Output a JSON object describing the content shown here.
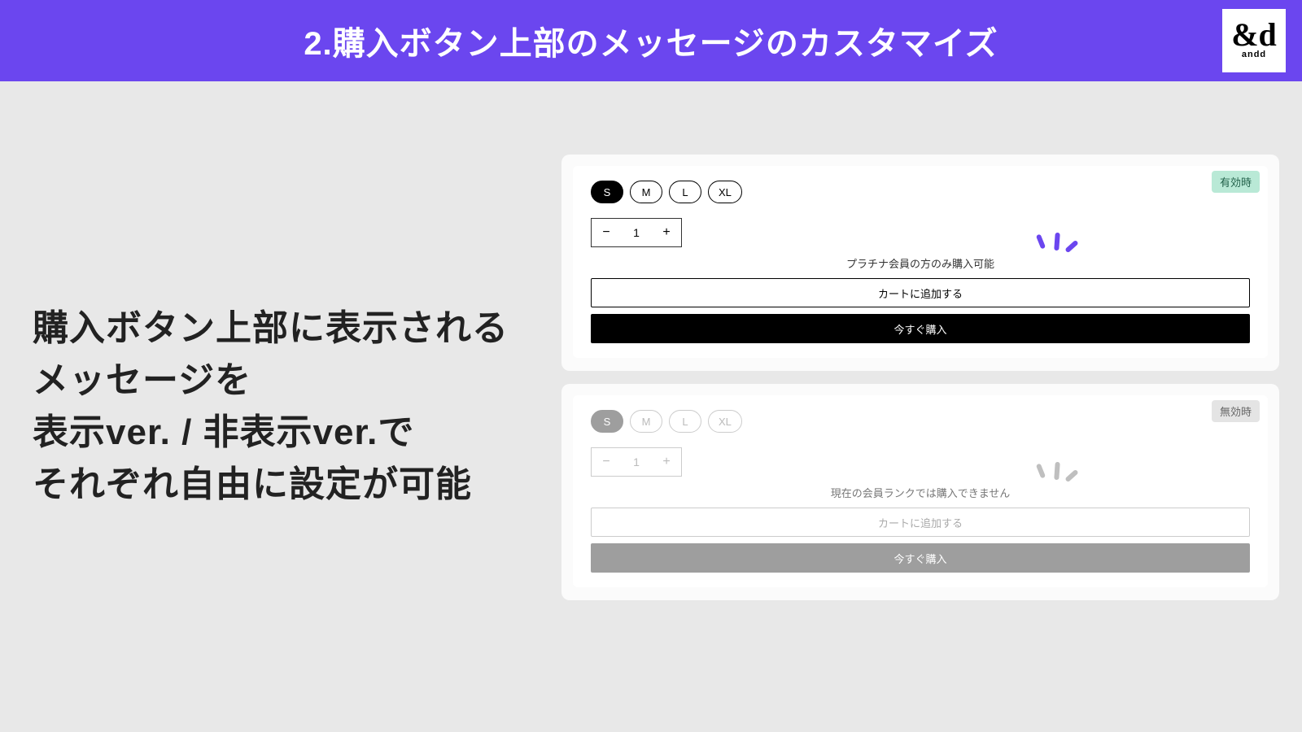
{
  "header": {
    "title": "2.購入ボタン上部のメッセージのカスタマイズ",
    "logo_amp": "&d",
    "logo_sub": "andd"
  },
  "description": "購入ボタン上部に表示されるメッセージを\n表示ver. / 非表示ver.で\nそれぞれ自由に設定が可能",
  "cards": {
    "enabled": {
      "badge": "有効時",
      "sizes": [
        "S",
        "M",
        "L",
        "XL"
      ],
      "selected_size": "S",
      "quantity": "1",
      "minus": "−",
      "plus": "+",
      "message": "プラチナ会員の方のみ購入可能",
      "add_to_cart": "カートに追加する",
      "buy_now": "今すぐ購入"
    },
    "disabled": {
      "badge": "無効時",
      "sizes": [
        "S",
        "M",
        "L",
        "XL"
      ],
      "selected_size": "S",
      "quantity": "1",
      "minus": "−",
      "plus": "+",
      "message": "現在の会員ランクでは購入できません",
      "add_to_cart": "カートに追加する",
      "buy_now": "今すぐ購入"
    }
  }
}
